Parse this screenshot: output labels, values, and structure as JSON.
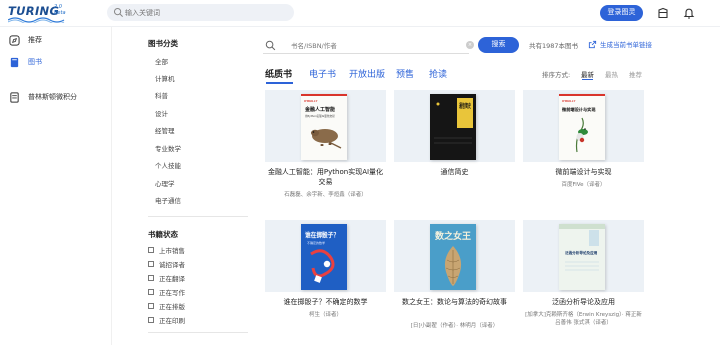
{
  "header": {
    "logo_main": "TURING",
    "logo_sub": "2.0 Beta",
    "search_placeholder": "输入关键词",
    "login_label": "登录图灵"
  },
  "sidebar": {
    "items": [
      {
        "label": "推荐",
        "icon": "compass-icon",
        "active": false
      },
      {
        "label": "图书",
        "icon": "book-icon",
        "active": true
      },
      {
        "label": "普林斯顿微积分",
        "icon": "course-book-icon",
        "active": false
      }
    ]
  },
  "categories": {
    "title": "图书分类",
    "items": [
      "全部",
      "计算机",
      "科普",
      "设计",
      "经管理",
      "专业数学",
      "个人技能",
      "心理学",
      "电子通信"
    ]
  },
  "status": {
    "title": "书籍状态",
    "items": [
      "上市销售",
      "诚招译者",
      "正在翻译",
      "正在写作",
      "正在排版",
      "正在印刷"
    ]
  },
  "main": {
    "isbn_placeholder": "书名/ISBN/作者",
    "search_label": "搜索",
    "total_text": "共有1987本图书",
    "generate_link": "生成当前书单链接",
    "tabs": [
      "纸质书",
      "电子书",
      "开放出版",
      "预售",
      "抢读"
    ],
    "sort_label": "排序方式:",
    "sort_options": [
      "最新",
      "最热",
      "推荐"
    ]
  },
  "books": [
    {
      "title": "金融人工智能：用Python实现AI量化交易",
      "author": "石磊磊、余宇新、李烜鑫（译者）"
    },
    {
      "title": "通信简史",
      "author": ""
    },
    {
      "title": "微前端设计与实现",
      "author": "百度FiVe（译者）"
    },
    {
      "title": "谁在掷骰子？不确定的数学",
      "author": "柯生（译者）"
    },
    {
      "title": "数之女王：数论与算法的奇幻故事",
      "author": "[日]小副翟（作者）· 林明月（译者）"
    },
    {
      "title": "泛函分析导论及应用",
      "author": "[加拿大]克赖斯齐格（Erwin Kreyszig）· 蒋正新 吕善伟 张式淇（译者）"
    }
  ],
  "covers": [
    {
      "title": "金融人工智能",
      "subtitle": "用Python实现AI量化交易",
      "publisher": "O'REILLY"
    },
    {
      "title": "通信简史",
      "subtitle": ""
    },
    {
      "title": "微前端设计与实现",
      "subtitle": "",
      "publisher": "O'REILLY"
    },
    {
      "title": "谁在掷骰子？",
      "subtitle": "不确定的数学"
    },
    {
      "title": "数之女王",
      "subtitle": ""
    },
    {
      "title": "泛函分析导论及应用",
      "subtitle": ""
    }
  ],
  "colors": {
    "accent": "#2d63d8",
    "cover_bg": "#ecf1f6"
  }
}
